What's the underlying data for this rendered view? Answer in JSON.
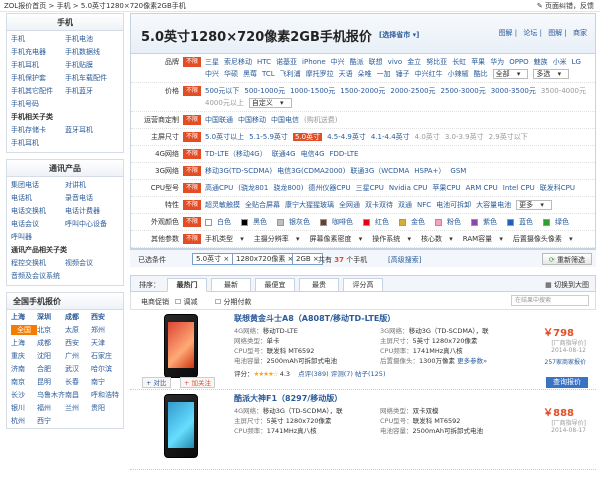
{
  "breadcrumb": {
    "items": [
      "ZOL报价首页",
      "手机",
      "5.0英寸1280×720像素2GB手机"
    ],
    "sep": ">",
    "feedback": "页面纠错，反馈"
  },
  "sidebar": {
    "phones_title": "手机",
    "phones_items": [
      "手机",
      "手机电池",
      "手机充电器",
      "手机数据线",
      "手机耳机",
      "手机贴膜",
      "手机保护套",
      "手机车载配件",
      "手机其它配件",
      "手机蓝牙",
      "手机号码"
    ],
    "phones_related_title": "手机相关子类",
    "phones_related_items": [
      "手机存储卡",
      "蓝牙耳机",
      "手机耳机"
    ],
    "comm_title": "通讯产品",
    "comm_items": [
      "集团电话",
      "对讲机",
      "电话机",
      "录音电话",
      "电话交换机",
      "电话计费器",
      "电话会议",
      "呼叫中心设备",
      "呼叫器"
    ],
    "comm_related_title": "通讯产品相关子类",
    "comm_related_items": [
      "程控交换机",
      "视频会议",
      "音频及会议系统"
    ],
    "cities_title": "全国手机报价",
    "cities_head": [
      "上海",
      "深圳",
      "成都",
      "西安"
    ],
    "cities": [
      "全国",
      "北京",
      "太原",
      "郑州",
      "上海",
      "成都",
      "西安",
      "天津",
      "重庆",
      "沈阳",
      "广州",
      "石家庄",
      "济南",
      "合肥",
      "武汉",
      "哈尔滨",
      "南京",
      "昆明",
      "长春",
      "南宁",
      "长沙",
      "乌鲁木齐",
      "南昌",
      "呼和浩特",
      "银川",
      "福州",
      "兰州",
      "贵阳",
      "杭州",
      "西宁"
    ]
  },
  "main": {
    "title": "5.0英寸1280×720像素2GB手机报价",
    "city_select": "[选择省市 ▾]",
    "links": [
      "图解",
      "论坛",
      "图解",
      "商家"
    ],
    "any_label": "不限",
    "filters": [
      {
        "label": "品牌",
        "options": [
          "三星",
          "索尼移动",
          "HTC",
          "诺基亚",
          "iPhone",
          "中兴",
          "酷派",
          "联想",
          "vivo",
          "金立",
          "努比亚",
          "长虹",
          "苹果",
          "华为",
          "OPPO",
          "魅族",
          "小米",
          "LG",
          "中兴",
          "华硕",
          "黑莓",
          "TCL",
          "飞利浦",
          "摩托罗拉",
          "天语",
          "朵唯",
          "一加",
          "锤子",
          "中兴红牛",
          "小辣椒",
          "酷比"
        ],
        "extra": [
          "全部",
          "多选"
        ]
      },
      {
        "label": "价格",
        "options": [
          "500元以下",
          "500-1000元",
          "1000-1500元",
          "1500-2000元",
          "2000-2500元",
          "2500-3000元",
          "3000-3500元",
          "3500-4000元",
          "4000元以上"
        ],
        "extra": [
          "自定义"
        ]
      },
      {
        "label": "运营商定制",
        "options": [
          "中国联通",
          "中国移动",
          "中国电信",
          "(购机送费)"
        ]
      },
      {
        "label": "主屏尺寸",
        "options": [
          "5.0英寸以上",
          "5.1-5.9英寸",
          "5.0英寸",
          "4.5-4.9英寸",
          "4.1-4.4英寸",
          "4.0英寸",
          "3.0-3.9英寸",
          "2.9英寸以下"
        ]
      },
      {
        "label": "4G网络",
        "options": [
          "TD-LTE（移动4G）",
          "联通4G",
          "电信4G",
          "FDD-LTE"
        ]
      },
      {
        "label": "3G网络",
        "options": [
          "移动3G(TD-SCDMA)",
          "电信3G(CDMA2000)",
          "联通3G（WCDMA",
          "HSPA+）",
          "GSM"
        ]
      },
      {
        "label": "CPU型号",
        "options": [
          "高通CPU",
          "(骁龙801",
          "骁龙800)",
          "德州仪器CPU",
          "三星CPU",
          "Nvidia CPU",
          "苹果CPU",
          "ARM CPU",
          "Intel CPU",
          "联发科CPU"
        ]
      },
      {
        "label": "特性",
        "options": [
          "超灵敏触摸",
          "全贴合屏幕",
          "康宁大猩猩玻璃",
          "全网通",
          "双卡双待",
          "双通",
          "NFC",
          "电池可拆卸",
          "大容量电池"
        ],
        "extra": [
          "更多"
        ]
      },
      {
        "label": "外观颜色",
        "colors": [
          {
            "name": "白色",
            "hex": "#ffffff"
          },
          {
            "name": "黑色",
            "hex": "#000000"
          },
          {
            "name": "银灰色",
            "hex": "#c0c0c0"
          },
          {
            "name": "咖啡色",
            "hex": "#6b3e26"
          },
          {
            "name": "红色",
            "hex": "#e60012"
          },
          {
            "name": "金色",
            "hex": "#d4af37"
          },
          {
            "name": "粉色",
            "hex": "#f7a1c4"
          },
          {
            "name": "紫色",
            "hex": "#8e44ad"
          },
          {
            "name": "蓝色",
            "hex": "#1f5fbf"
          },
          {
            "name": "绿色",
            "hex": "#2e9e2e"
          }
        ]
      },
      {
        "label": "其他参数",
        "dropdowns": [
          "手机类型",
          "主摄分辨率",
          "屏幕像素密度",
          "操作系统",
          "核心数",
          "RAM容量",
          "后置摄像头像素"
        ]
      }
    ],
    "selected_label": "已选条件",
    "selected_tags": [
      "5.0英寸 ×",
      "1280x720像素 ×",
      "2GB ×"
    ],
    "count_text": [
      "共有",
      "37",
      "个手机"
    ],
    "advanced": "[高级搜索]",
    "reset": "重新筛选",
    "sort_label": "排序：",
    "sort_tabs": [
      "最热门",
      "最新",
      "最便宜",
      "最贵",
      "评分高"
    ],
    "switch_view": "切换到大图",
    "checks": [
      "电商促销",
      "调减",
      "分期付款"
    ],
    "search_placeholder": "在结果中搜索",
    "products": [
      {
        "name": "联想黄金斗士A8（A808T/移动TD-LTE版）",
        "specs": [
          [
            "4G网络：",
            "移动TD-LTE"
          ],
          [
            "3G网络：",
            "移动3G（TD-SCDMA），联"
          ],
          [
            "网络类型：",
            "单卡"
          ],
          [
            "主屏尺寸：",
            "5英寸 1280x720像素"
          ],
          [
            "CPU型号：",
            "联发科 MT6592"
          ],
          [
            "CPU频率：",
            "1741MHz真八核"
          ],
          [
            "电池容量：",
            "2500mAh可拆卸式电池"
          ],
          [
            "后置摄像头：",
            "1300万像素"
          ]
        ],
        "more": "更多参数»",
        "price": "￥798",
        "price_note1": "[厂商指导价]",
        "price_date": "2014-08-12",
        "merchant": "257家商家报价",
        "rating_label": "评分：",
        "stars": "★★★★☆",
        "score": "4.3",
        "comments": "点评(389)",
        "reviews": "评测(7)",
        "posts": "帖子(125)",
        "compare": "+ 对比",
        "fav": "+ 加关注",
        "query": "查询报价"
      },
      {
        "name": "酷派大神F1（8297/移动版）",
        "specs": [
          [
            "4G网络：",
            "移动3G（TD-SCDMA），联"
          ],
          [
            "网络类型：",
            "双卡双模"
          ],
          [
            "主屏尺寸：",
            "5英寸 1280x720像素"
          ],
          [
            "CPU型号：",
            "联发科 MT6592"
          ],
          [
            "CPU频率：",
            "1741MHz真八核"
          ],
          [
            "电池容量：",
            "2500mAh可拆卸式电池"
          ]
        ],
        "price": "￥888",
        "price_note1": "[厂商指导价]",
        "price_date": "2014-08-17"
      }
    ]
  }
}
